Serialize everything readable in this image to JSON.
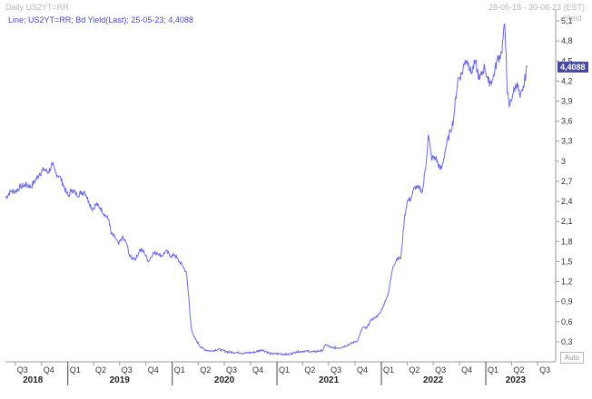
{
  "header": {
    "title": "Daily US2YT=RR",
    "date_range": "28-05-18 - 30-08-23 (EST)"
  },
  "legend": {
    "text": "Line; US2YT=RR; Bd Yield(Last); 25-05-23; 4,4088"
  },
  "auto_button": "Auto",
  "chart_data": {
    "type": "line",
    "title": "Daily US2YT=RR",
    "ylabel": "Yield",
    "ylim": [
      0,
      5.25
    ],
    "xlim": [
      "2018-05-28",
      "2023-08-30"
    ],
    "grid": false,
    "legend": "top-left",
    "colors": {
      "line": "#6a6ae0",
      "current_value_bg": "#4a4aa0"
    },
    "yticks": [
      "5,1",
      "4,8",
      "4,5",
      "4,2",
      "3,9",
      "3,6",
      "3,3",
      "3",
      "2,7",
      "2,4",
      "2,1",
      "1,8",
      "1,5",
      "1,2",
      "0,9",
      "0,6",
      "0,3"
    ],
    "ytick_values": [
      5.1,
      4.8,
      4.5,
      4.2,
      3.9,
      3.6,
      3.3,
      3.0,
      2.7,
      2.4,
      2.1,
      1.8,
      1.5,
      1.2,
      0.9,
      0.6,
      0.3
    ],
    "current_value_label": "4,4088",
    "current_value": 4.4088,
    "quarters": [
      {
        "label": "Q3",
        "date": "2018-07-01"
      },
      {
        "label": "Q4",
        "date": "2018-10-01"
      },
      {
        "label": "Q1",
        "date": "2019-01-01"
      },
      {
        "label": "Q2",
        "date": "2019-04-01"
      },
      {
        "label": "Q3",
        "date": "2019-07-01"
      },
      {
        "label": "Q4",
        "date": "2019-10-01"
      },
      {
        "label": "Q1",
        "date": "2020-01-01"
      },
      {
        "label": "Q2",
        "date": "2020-04-01"
      },
      {
        "label": "Q3",
        "date": "2020-07-01"
      },
      {
        "label": "Q4",
        "date": "2020-10-01"
      },
      {
        "label": "Q1",
        "date": "2021-01-01"
      },
      {
        "label": "Q2",
        "date": "2021-04-01"
      },
      {
        "label": "Q3",
        "date": "2021-07-01"
      },
      {
        "label": "Q4",
        "date": "2021-10-01"
      },
      {
        "label": "Q1",
        "date": "2022-01-01"
      },
      {
        "label": "Q2",
        "date": "2022-04-01"
      },
      {
        "label": "Q3",
        "date": "2022-07-01"
      },
      {
        "label": "Q4",
        "date": "2022-10-01"
      },
      {
        "label": "Q1",
        "date": "2023-01-01"
      },
      {
        "label": "Q2",
        "date": "2023-04-01"
      },
      {
        "label": "Q3",
        "date": "2023-07-01"
      }
    ],
    "years": [
      {
        "label": "2018",
        "date": "2018-09-01"
      },
      {
        "label": "2019",
        "date": "2019-07-01"
      },
      {
        "label": "2020",
        "date": "2020-07-01"
      },
      {
        "label": "2021",
        "date": "2021-07-01"
      },
      {
        "label": "2022",
        "date": "2022-07-01"
      },
      {
        "label": "2023",
        "date": "2023-04-15"
      }
    ],
    "series": [
      {
        "x": [
          "2018-05-28",
          "2018-06-15",
          "2018-07-01",
          "2018-07-20",
          "2018-08-10",
          "2018-08-25",
          "2018-09-10",
          "2018-09-25",
          "2018-10-10",
          "2018-10-25",
          "2018-11-08",
          "2018-11-20",
          "2018-12-03",
          "2018-12-15",
          "2018-12-28",
          "2019-01-03",
          "2019-01-15",
          "2019-02-01",
          "2019-02-15",
          "2019-03-01",
          "2019-03-15",
          "2019-03-29",
          "2019-04-10",
          "2019-04-25",
          "2019-05-10",
          "2019-05-25",
          "2019-06-01",
          "2019-06-15",
          "2019-06-28",
          "2019-07-10",
          "2019-07-25",
          "2019-08-05",
          "2019-08-15",
          "2019-08-28",
          "2019-09-10",
          "2019-09-25",
          "2019-10-10",
          "2019-10-25",
          "2019-11-10",
          "2019-11-25",
          "2019-12-10",
          "2019-12-28",
          "2020-01-10",
          "2020-01-25",
          "2020-02-05",
          "2020-02-20",
          "2020-02-28",
          "2020-03-03",
          "2020-03-09",
          "2020-03-16",
          "2020-03-25",
          "2020-04-10",
          "2020-04-25",
          "2020-05-15",
          "2020-06-10",
          "2020-07-10",
          "2020-08-10",
          "2020-09-10",
          "2020-10-10",
          "2020-11-10",
          "2020-12-10",
          "2021-01-10",
          "2021-02-10",
          "2021-03-10",
          "2021-04-10",
          "2021-05-10",
          "2021-06-10",
          "2021-06-20",
          "2021-07-10",
          "2021-08-10",
          "2021-09-10",
          "2021-10-10",
          "2021-10-28",
          "2021-11-10",
          "2021-11-25",
          "2021-12-10",
          "2021-12-28",
          "2022-01-10",
          "2022-01-25",
          "2022-02-10",
          "2022-02-25",
          "2022-03-10",
          "2022-03-22",
          "2022-04-01",
          "2022-04-15",
          "2022-04-28",
          "2022-05-10",
          "2022-05-25",
          "2022-06-08",
          "2022-06-14",
          "2022-06-25",
          "2022-07-10",
          "2022-07-25",
          "2022-08-01",
          "2022-08-15",
          "2022-08-30",
          "2022-09-10",
          "2022-09-25",
          "2022-10-10",
          "2022-10-21",
          "2022-11-01",
          "2022-11-10",
          "2022-11-25",
          "2022-12-10",
          "2022-12-28",
          "2023-01-10",
          "2023-01-25",
          "2023-02-10",
          "2023-02-25",
          "2023-03-08",
          "2023-03-13",
          "2023-03-17",
          "2023-03-24",
          "2023-04-05",
          "2023-04-20",
          "2023-05-01",
          "2023-05-10",
          "2023-05-25"
        ],
        "y": [
          2.45,
          2.55,
          2.55,
          2.62,
          2.65,
          2.62,
          2.72,
          2.82,
          2.88,
          2.84,
          2.95,
          2.82,
          2.78,
          2.66,
          2.52,
          2.48,
          2.58,
          2.5,
          2.52,
          2.55,
          2.4,
          2.28,
          2.36,
          2.3,
          2.2,
          2.12,
          1.92,
          1.86,
          1.76,
          1.86,
          1.78,
          1.58,
          1.55,
          1.55,
          1.68,
          1.64,
          1.5,
          1.62,
          1.63,
          1.58,
          1.66,
          1.58,
          1.6,
          1.5,
          1.45,
          1.32,
          0.95,
          0.7,
          0.48,
          0.38,
          0.32,
          0.22,
          0.18,
          0.16,
          0.19,
          0.15,
          0.14,
          0.13,
          0.14,
          0.18,
          0.12,
          0.12,
          0.11,
          0.15,
          0.16,
          0.15,
          0.17,
          0.26,
          0.21,
          0.21,
          0.26,
          0.32,
          0.52,
          0.5,
          0.62,
          0.66,
          0.73,
          0.86,
          1.02,
          1.42,
          1.55,
          1.55,
          2.12,
          2.4,
          2.45,
          2.62,
          2.6,
          2.55,
          3.05,
          3.4,
          3.05,
          3.05,
          2.88,
          2.92,
          3.22,
          3.45,
          3.62,
          4.22,
          4.32,
          4.52,
          4.48,
          4.32,
          4.48,
          4.22,
          4.42,
          4.18,
          4.22,
          4.52,
          4.62,
          5.05,
          4.62,
          4.02,
          3.82,
          4.0,
          4.18,
          3.95,
          4.05,
          4.41
        ]
      }
    ]
  }
}
